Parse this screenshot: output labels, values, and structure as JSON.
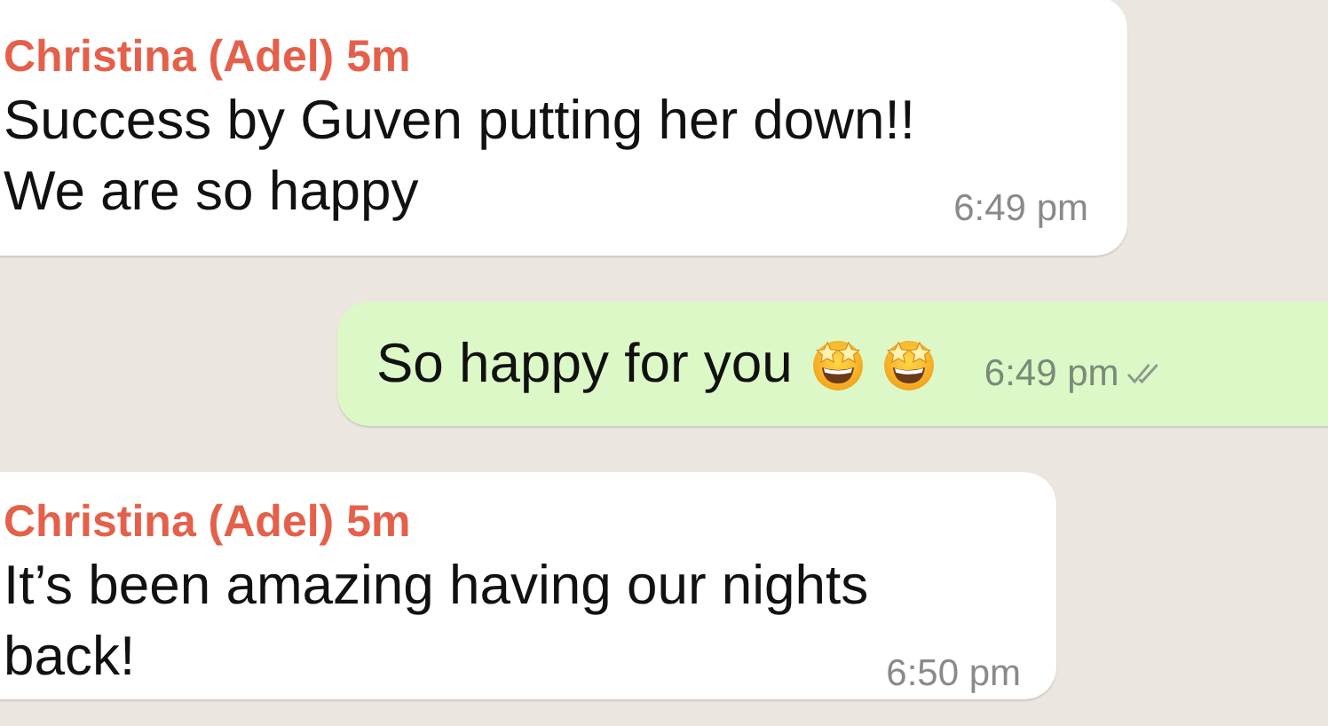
{
  "messages": [
    {
      "kind": "incoming",
      "sender": "Christina (Adel) 5m",
      "text": "Success by Guven putting her down!!\nWe are so happy",
      "time": "6:49 pm"
    },
    {
      "kind": "outgoing",
      "text": "So happy for you",
      "emojis": [
        {
          "kind": "star_struck"
        },
        {
          "kind": "star_struck"
        }
      ],
      "time": "6:49 pm",
      "read": false
    },
    {
      "kind": "incoming",
      "sender": "Christina (Adel) 5m",
      "text": "It’s been amazing having our nights\nback!",
      "time": "6:50 pm"
    }
  ]
}
